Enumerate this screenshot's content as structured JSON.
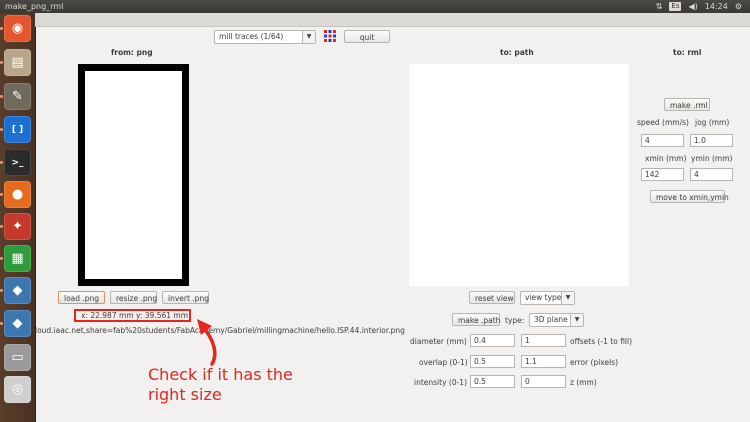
{
  "window": {
    "title": "make_png_rml",
    "clock": "14:24",
    "keyboard": "Es"
  },
  "launcher": {
    "items": [
      {
        "name": "ubuntu-logo-icon",
        "color": "#e4572e",
        "glyph": "◉"
      },
      {
        "name": "files-icon",
        "color": "#b7a68a",
        "glyph": "▤"
      },
      {
        "name": "gimp-icon",
        "color": "#6f6a5c",
        "glyph": "✎"
      },
      {
        "name": "brackets-icon",
        "color": "#1d6fd1",
        "glyph": "[ ]"
      },
      {
        "name": "terminal-icon",
        "color": "#2b2b2b",
        "glyph": ">_"
      },
      {
        "name": "firefox-icon",
        "color": "#e66b1e",
        "glyph": "●"
      },
      {
        "name": "settings-icon",
        "color": "#c43a2a",
        "glyph": "✦"
      },
      {
        "name": "spreadsheet-icon",
        "color": "#2e9c3a",
        "glyph": "▦"
      },
      {
        "name": "python-icon",
        "color": "#3d77b0",
        "glyph": "◆"
      },
      {
        "name": "python-icon-2",
        "color": "#3d77b0",
        "glyph": "◆"
      },
      {
        "name": "drive-icon",
        "color": "#9a9a9a",
        "glyph": "▭"
      },
      {
        "name": "disc-icon",
        "color": "#cfcfcf",
        "glyph": "◎"
      }
    ]
  },
  "toolbar": {
    "process": "mill traces (1/64)",
    "quit": "quit"
  },
  "panel_png": {
    "heading": "from: png",
    "load": "load .png",
    "resize": "resize .png",
    "invert": "invert .png",
    "size_readout": "x: 22.987 mm  y: 39.561 mm",
    "file_path": "loud.iaac.net,share=fab%20students/FabAcademy/Gabriel/millingmachine/hello.ISP.44.interior.png"
  },
  "panel_path": {
    "heading": "to: path",
    "reset_view": "reset view",
    "view_type": "view type",
    "make_path": "make .path",
    "type_label": "type:",
    "type_value": "3D plane",
    "rows": [
      {
        "label": "diameter (mm)",
        "value": "0.4",
        "value2": "1",
        "label2": "offsets (-1 to fill)"
      },
      {
        "label": "overlap (0-1)",
        "value": "0.5",
        "value2": "1.1",
        "label2": "error (pixels)"
      },
      {
        "label": "intensity (0-1)",
        "value": "0.5",
        "value2": "0",
        "label2": "z (mm)"
      }
    ]
  },
  "panel_rml": {
    "heading": "to: rml",
    "make_rml": "make .rml",
    "speed_label": "speed (mm/s)",
    "jog_label": "jog (mm)",
    "speed": "4",
    "jog": "1.0",
    "xmin_label": "xmin (mm)",
    "ymin_label": "ymin (mm)",
    "xmin": "142",
    "ymin": "4",
    "move": "move to xmin,ymin"
  },
  "annotation": {
    "text": "Check if it has the right size",
    "color": "#e4261c"
  }
}
